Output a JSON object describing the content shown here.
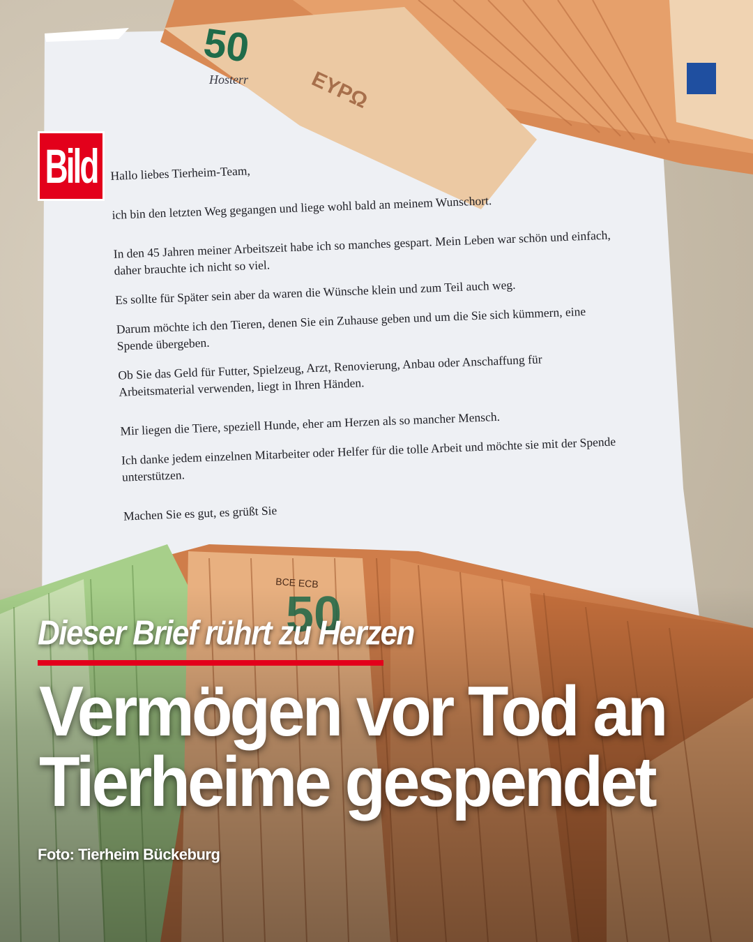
{
  "brand": {
    "logo_text": "Bild",
    "logo_color": "#e3001b"
  },
  "photo": {
    "letterhead_partial": "Hosterr",
    "banknote_texts": {
      "denomination": "50",
      "currency_word": "ΕΥΡΩ",
      "bank_text": "BCE ECB"
    },
    "letter": {
      "greeting": "Hallo liebes Tierheim-Team,",
      "paragraphs": [
        "ich bin den letzten Weg gegangen und liege wohl bald an meinem Wunschort.",
        "In den 45 Jahren meiner Arbeitszeit habe ich so manches gespart. Mein Leben war schön und einfach, daher brauchte ich nicht so viel.",
        "Es sollte für Später sein aber da waren die Wünsche klein  und zum Teil auch weg.",
        "Darum möchte ich den Tieren, denen Sie ein Zuhause geben und um die Sie sich kümmern, eine Spende übergeben.",
        "Ob Sie das Geld für Futter, Spielzeug, Arzt, Renovierung, Anbau oder Anschaffung für Arbeitsmaterial verwenden, liegt in Ihren Händen.",
        "Mir liegen die Tiere, speziell Hunde, eher am Herzen als so mancher Mensch.",
        "Ich danke jedem einzelnen Mitarbeiter oder Helfer für die tolle Arbeit und möchte sie mit der Spende unterstützen."
      ],
      "closing": "Machen Sie es gut, es grüßt Sie"
    }
  },
  "overlay": {
    "kicker": "Dieser Brief rührt zu Herzen",
    "headline_line1": "Vermögen vor Tod an",
    "headline_line2": "Tierheime gespendet",
    "credit": "Foto: Tierheim Bückeburg",
    "accent_color": "#e3001b"
  }
}
